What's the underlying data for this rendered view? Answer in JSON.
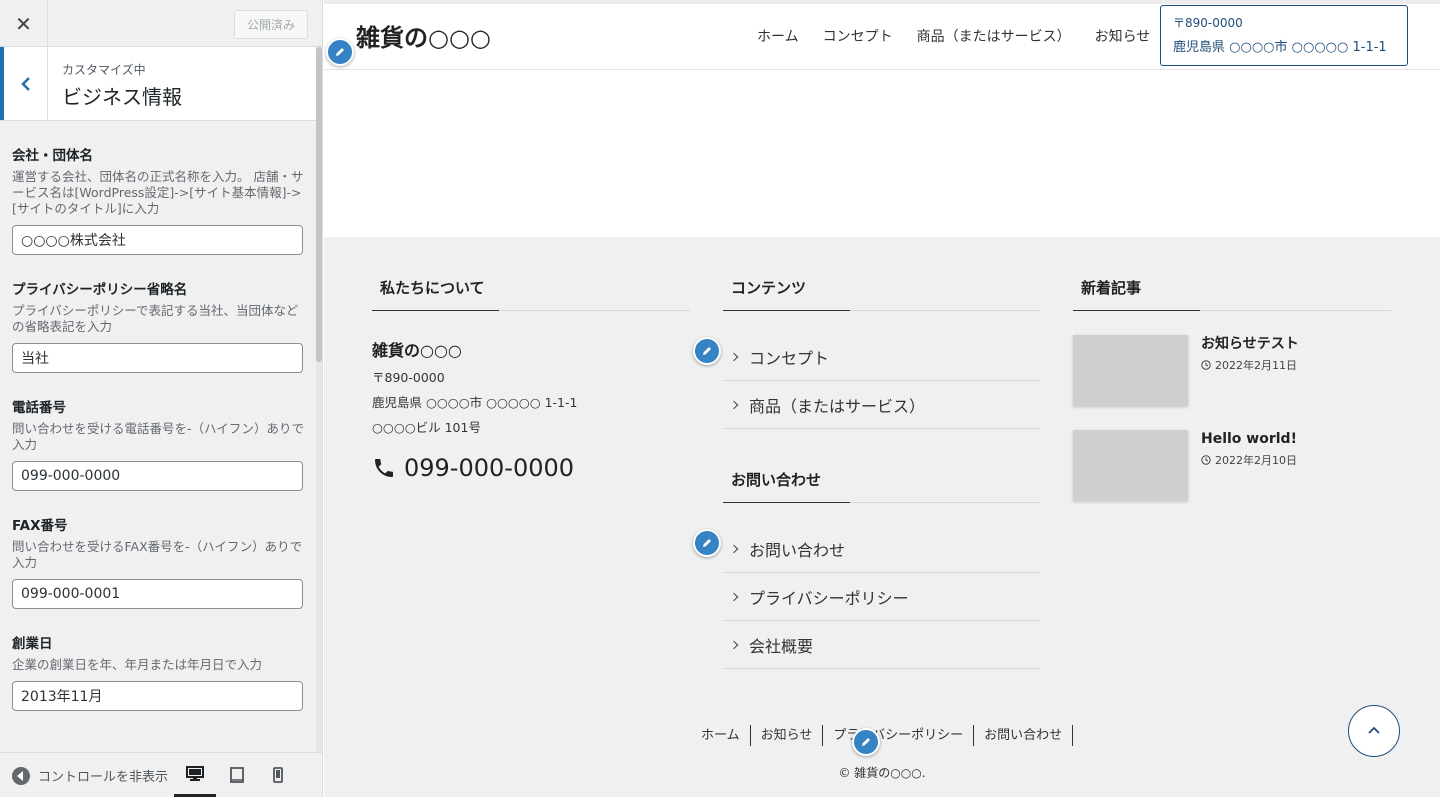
{
  "sidebar": {
    "publish_label": "公開済み",
    "section_subtitle": "カスタマイズ中",
    "section_title": "ビジネス情報",
    "controls": [
      {
        "label": "会社・団体名",
        "description": "運営する会社、団体名の正式名称を入力。 店舗・サービス名は[WordPress設定]->[サイト基本情報]->[サイトのタイトル]に入力",
        "value": "○○○○株式会社"
      },
      {
        "label": "プライバシーポリシー省略名",
        "description": "プライバシーポリシーで表記する当社、当団体などの省略表記を入力",
        "value": "当社"
      },
      {
        "label": "電話番号",
        "description": "問い合わせを受ける電話番号を-（ハイフン）ありで入力",
        "value": "099-000-0000"
      },
      {
        "label": "FAX番号",
        "description": "問い合わせを受けるFAX番号を-（ハイフン）ありで入力",
        "value": "099-000-0001"
      },
      {
        "label": "創業日",
        "description": "企業の創業日を年、年月または年月日で入力",
        "value": "2013年11月"
      }
    ],
    "collapse_label": "コントロールを非表示"
  },
  "preview": {
    "site_title": "雑貨の○○○",
    "nav": [
      "ホーム",
      "コンセプト",
      "商品（またはサービス）",
      "お知らせ"
    ],
    "header_contact": {
      "postal": "〒890-0000",
      "address": "鹿児島県 ○○○○市 ○○○○○ 1-1-1"
    },
    "footer": {
      "about": {
        "title": "私たちについて",
        "name": "雑貨の○○○",
        "postal": "〒890-0000",
        "address1": "鹿児島県 ○○○○市 ○○○○○ 1-1-1",
        "address2": "○○○○ビル 101号",
        "phone": "099-000-0000"
      },
      "contents": {
        "title": "コンテンツ",
        "items": [
          "コンセプト",
          "商品（またはサービス）"
        ]
      },
      "contact": {
        "title": "お問い合わせ",
        "items": [
          "お問い合わせ",
          "プライバシーポリシー",
          "会社概要"
        ]
      },
      "recent": {
        "title": "新着記事",
        "posts": [
          {
            "title": "お知らせテスト",
            "date": "2022年2月11日"
          },
          {
            "title": "Hello world!",
            "date": "2022年2月10日"
          }
        ]
      },
      "nav": [
        "ホーム",
        "お知らせ",
        "プライバシーポリシー",
        "お問い合わせ"
      ],
      "copyright": "© 雑貨の○○○."
    }
  },
  "colors": {
    "accent": "#2271b1",
    "pencil": "#3582c4",
    "brand": "#1f4d7a",
    "footer_bg": "#f0f0f0"
  }
}
